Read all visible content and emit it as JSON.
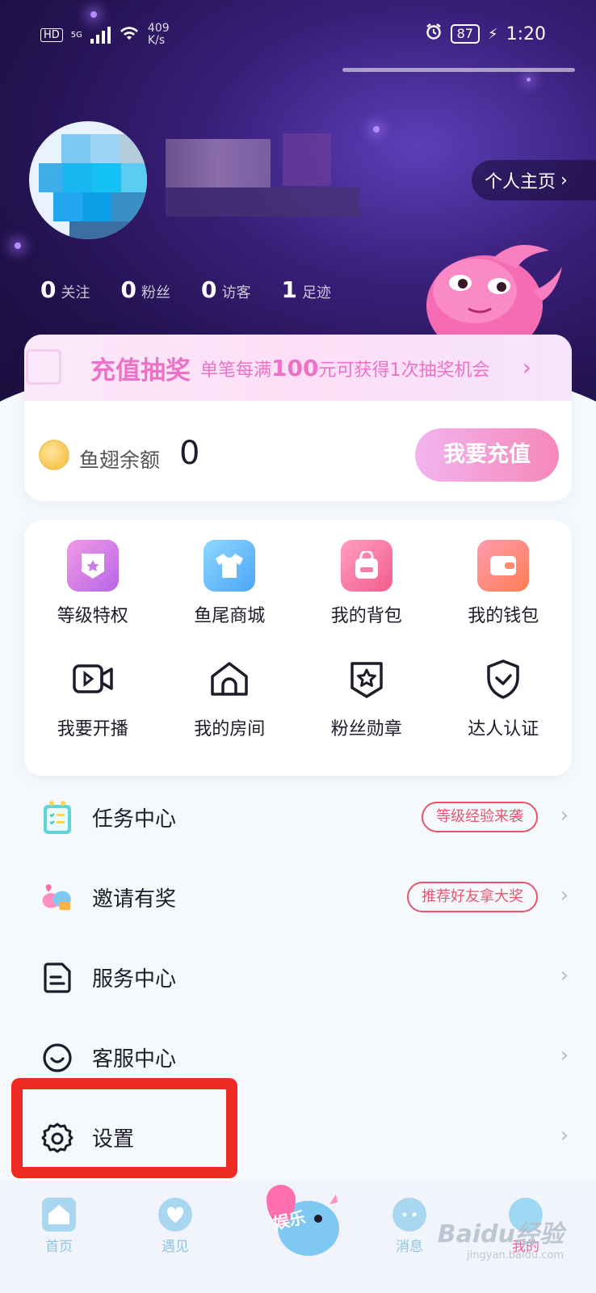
{
  "status_bar": {
    "network": "HD",
    "signal_label": "5G",
    "speed_value": "409",
    "speed_unit": "K/s",
    "battery": "87",
    "time": "1:20"
  },
  "profile": {
    "homepage_button": "个人主页",
    "stats": [
      {
        "value": "0",
        "label": "关注"
      },
      {
        "value": "0",
        "label": "粉丝"
      },
      {
        "value": "0",
        "label": "访客"
      },
      {
        "value": "1",
        "label": "足迹"
      }
    ]
  },
  "recharge": {
    "lottery_title": "充值抽奖",
    "lottery_desc_pre": "单笔每满",
    "lottery_amount": "100",
    "lottery_desc_post": "元可获得1次抽奖机会",
    "balance_label": "鱼翅余额",
    "balance_value": "0",
    "recharge_button": "我要充值"
  },
  "grid": {
    "items": [
      {
        "label": "等级特权",
        "icon": "level-privilege-icon"
      },
      {
        "label": "鱼尾商城",
        "icon": "shop-icon"
      },
      {
        "label": "我的背包",
        "icon": "backpack-icon"
      },
      {
        "label": "我的钱包",
        "icon": "wallet-icon"
      },
      {
        "label": "我要开播",
        "icon": "video-camera-icon"
      },
      {
        "label": "我的房间",
        "icon": "home-icon"
      },
      {
        "label": "粉丝勋章",
        "icon": "badge-star-icon"
      },
      {
        "label": "达人认证",
        "icon": "shield-check-icon"
      }
    ]
  },
  "menu": {
    "items": [
      {
        "label": "任务中心",
        "tag": "等级经验来袭"
      },
      {
        "label": "邀请有奖",
        "tag": "推荐好友拿大奖"
      },
      {
        "label": "服务中心",
        "tag": ""
      },
      {
        "label": "客服中心",
        "tag": ""
      },
      {
        "label": "设置",
        "tag": ""
      }
    ]
  },
  "bottom_nav": {
    "items": [
      {
        "label": "首页"
      },
      {
        "label": "遇见"
      },
      {
        "label": "娱乐"
      },
      {
        "label": "消息"
      },
      {
        "label": "我的"
      }
    ]
  },
  "watermark": {
    "brand": "Baidu经验",
    "url": "jingyan.baidu.com"
  },
  "colors": {
    "accent_pink": "#ec72c8",
    "tag_red": "#e8546f",
    "highlight_red": "#ee2b23",
    "nav_active": "#ff53a7"
  }
}
